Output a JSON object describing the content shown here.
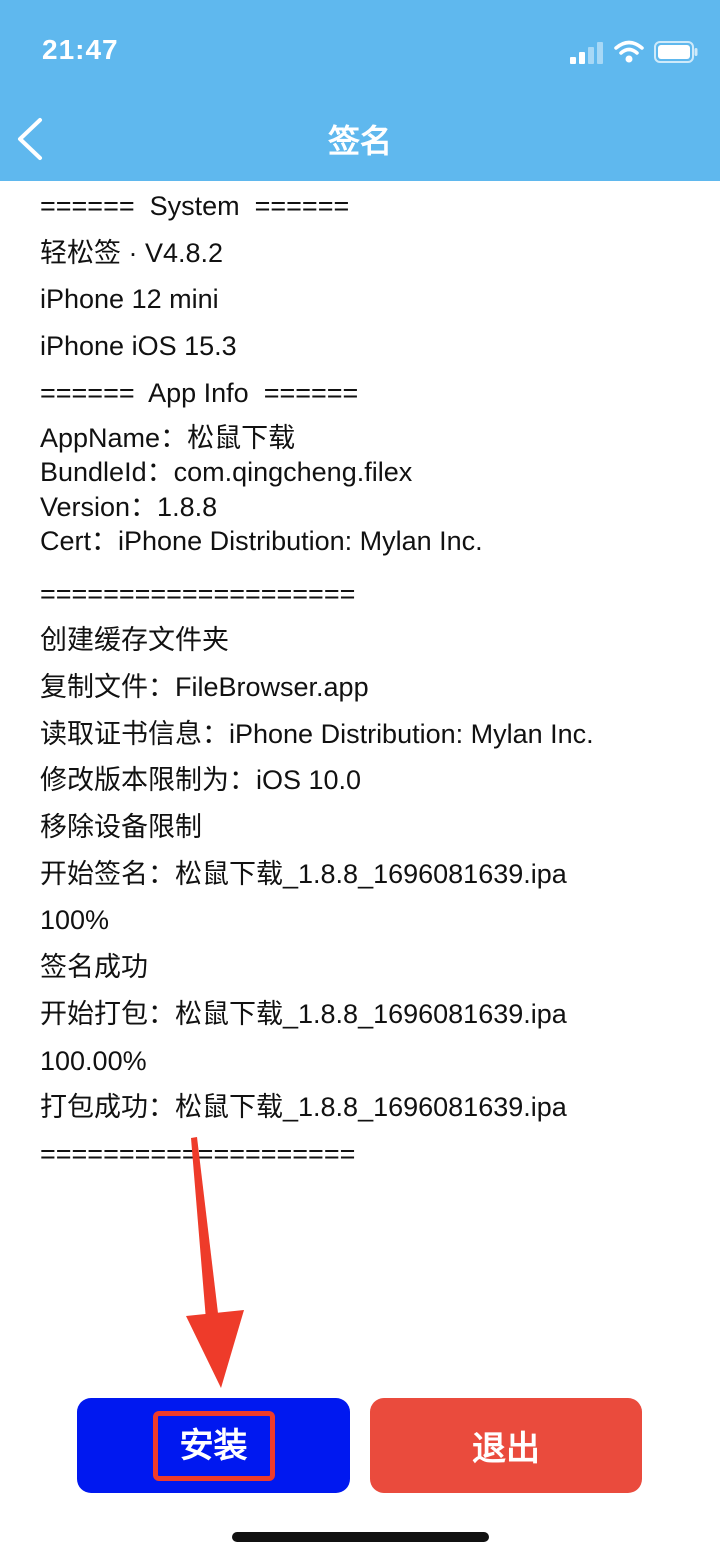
{
  "status_bar": {
    "time": "21:47"
  },
  "nav": {
    "title": "签名",
    "back_icon": "chevron-left-icon"
  },
  "log": {
    "system_lines": [
      "======  System  ======",
      "轻松签 · V4.8.2",
      "iPhone 12 mini",
      "iPhone iOS 15.3",
      "======  App Info  ======"
    ],
    "app_info_lines": [
      "AppName：松鼠下载",
      "BundleId：com.qingcheng.filex",
      "Version：1.8.8",
      "Cert：iPhone Distribution: Mylan Inc."
    ],
    "process_lines": [
      "====================",
      "创建缓存文件夹",
      "复制文件：FileBrowser.app",
      "读取证书信息：iPhone Distribution: Mylan Inc.",
      "修改版本限制为：iOS 10.0",
      "移除设备限制",
      "开始签名：松鼠下载_1.8.8_1696081639.ipa",
      "100%",
      "签名成功",
      "开始打包：松鼠下载_1.8.8_1696081639.ipa",
      "100.00%",
      "打包成功：松鼠下载_1.8.8_1696081639.ipa",
      "===================="
    ]
  },
  "buttons": {
    "install_label": "安装",
    "quit_label": "退出"
  },
  "colors": {
    "header": "#5fb8ee",
    "install_button": "#0018f0",
    "quit_button": "#ea4b3d",
    "annotation": "#ee3b2a"
  }
}
